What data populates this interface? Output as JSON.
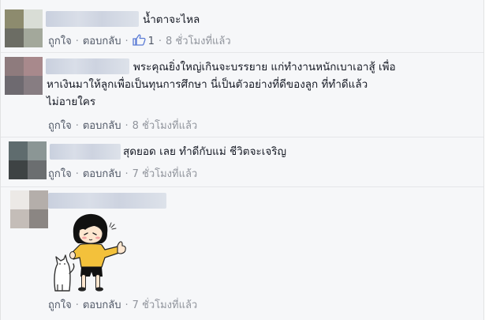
{
  "comments": [
    {
      "text_lines": [
        "น้ำตาจะไหล"
      ],
      "like_label": "ถูกใจ",
      "reply_label": "ตอบกลับ",
      "like_count": "1",
      "time": "8 ชั่วโมงที่แล้ว"
    },
    {
      "text_lines": [
        "พระคุณยิ่งใหญ่เกินจะบรรยาย แก่ทำงานหนักเบาเอาสู้ เพื่อ",
        "หาเงินมาให้ลูกเพื่อเป็นทุนการศึกษา นี่เป็นตัวอย่างที่ดีของลูก ที่ทำดีแล้ว",
        "ไม่อายใคร"
      ],
      "like_label": "ถูกใจ",
      "reply_label": "ตอบกลับ",
      "time": "8 ชั่วโมงที่แล้ว"
    },
    {
      "text_lines": [
        "สุดยอด เลย ทำดีกับแม่ ชีวิตจะเจริญ"
      ],
      "like_label": "ถูกใจ",
      "reply_label": "ตอบกลับ",
      "time": "7 ชั่วโมงที่แล้ว"
    },
    {
      "sticker": "girl-thumbs-up-with-cat",
      "like_label": "ถูกใจ",
      "reply_label": "ตอบกลับ",
      "time": "7 ชั่วโมงที่แล้ว"
    }
  ],
  "separator": "·",
  "colors": {
    "background": "#f6f7f9",
    "meta_text": "#90949c",
    "link_text": "#4e5665",
    "like_icon": "#5b7bd5"
  },
  "icons": {
    "like": "thumbs-up-icon"
  }
}
